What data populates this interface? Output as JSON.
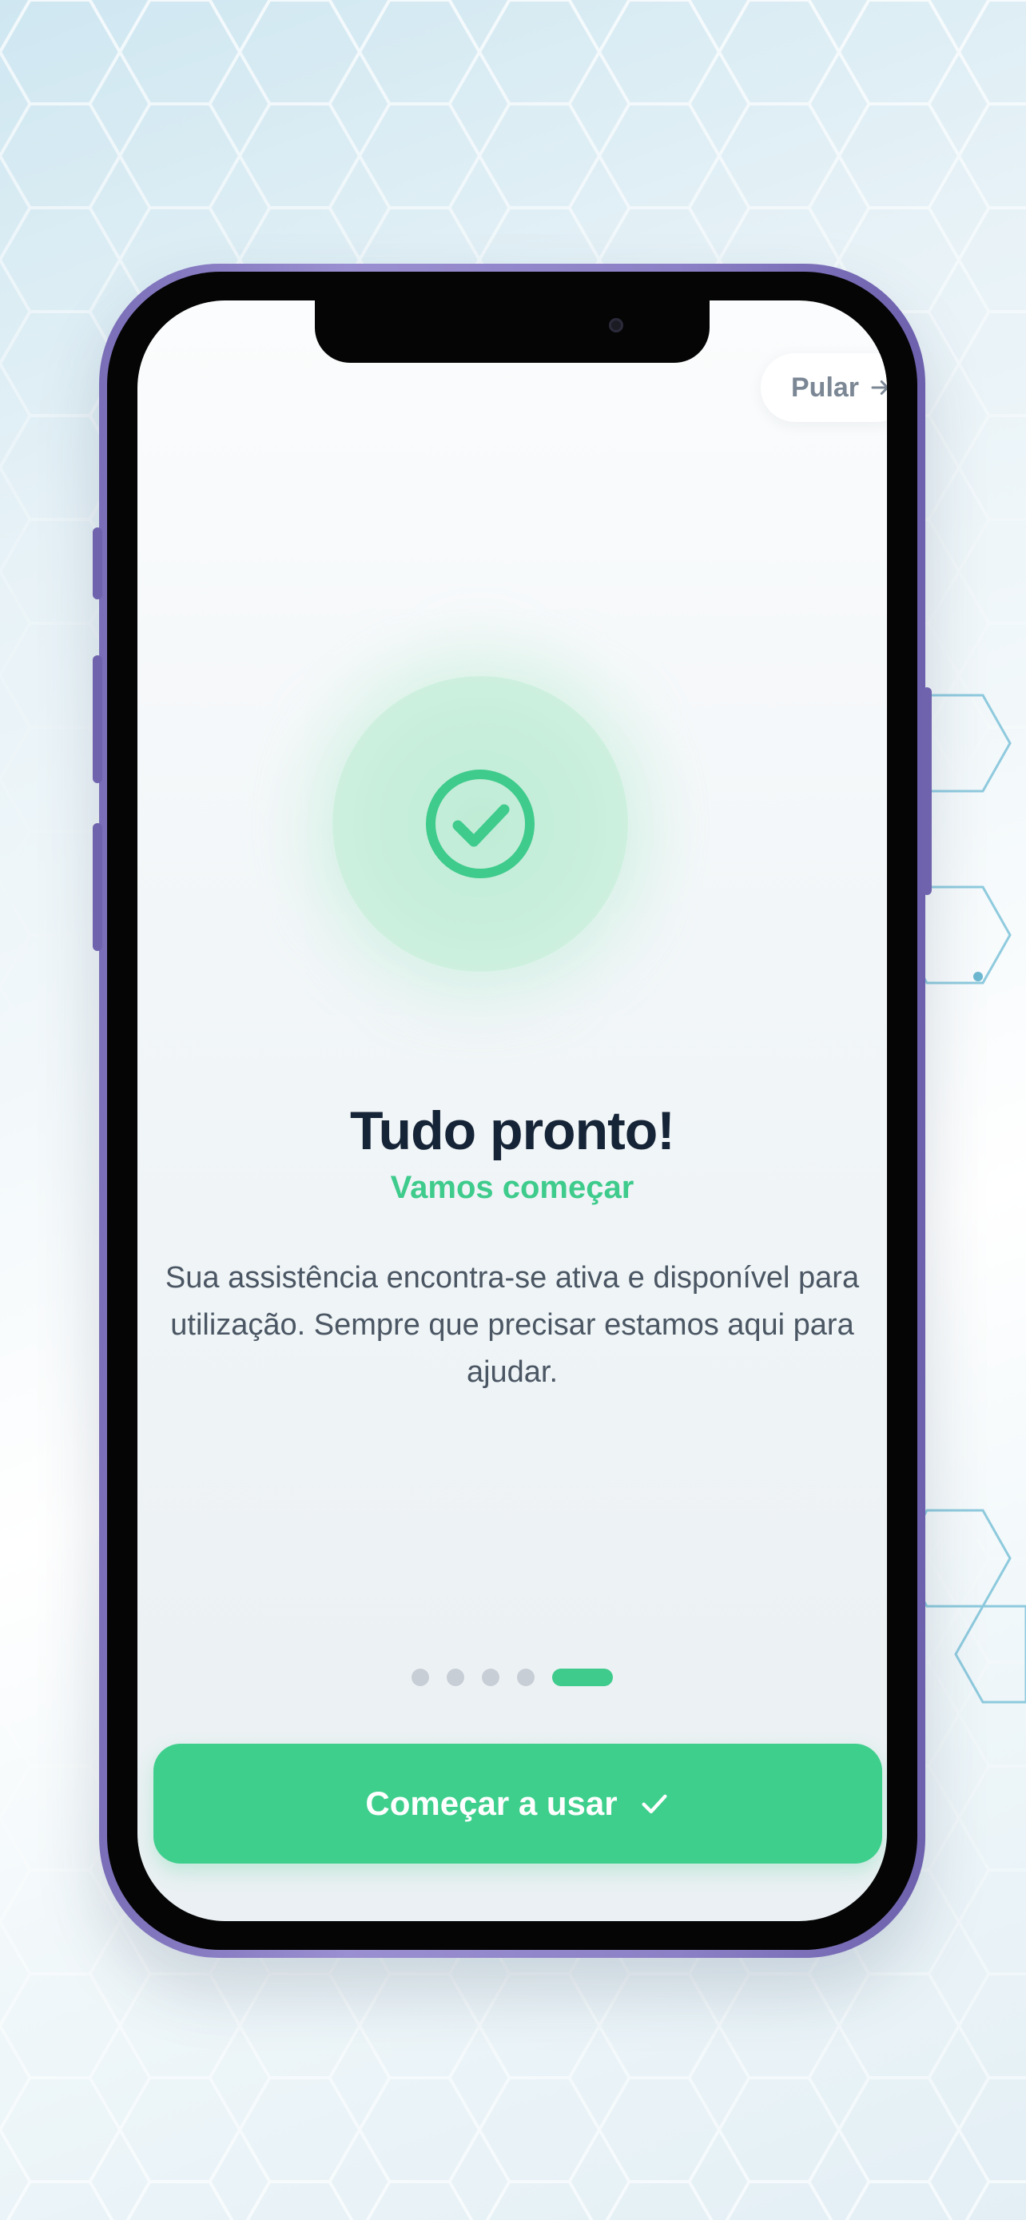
{
  "onboarding": {
    "skip_label": "Pular",
    "title": "Tudo pronto!",
    "subtitle": "Vamos começar",
    "description": "Sua assistência encontra-se ativa e disponível para utilização. Sempre que precisar estamos aqui para ajudar.",
    "pagination": {
      "total": 5,
      "current": 5
    },
    "cta_label": "Começar a usar"
  },
  "icons": {
    "skip": "arrow-right-icon",
    "success": "check-circle-icon",
    "cta": "checkmark-icon"
  },
  "colors": {
    "accent": "#3fcf8d",
    "title": "#152437",
    "text": "#4a5663",
    "phone_frame": "#8c80c6"
  }
}
